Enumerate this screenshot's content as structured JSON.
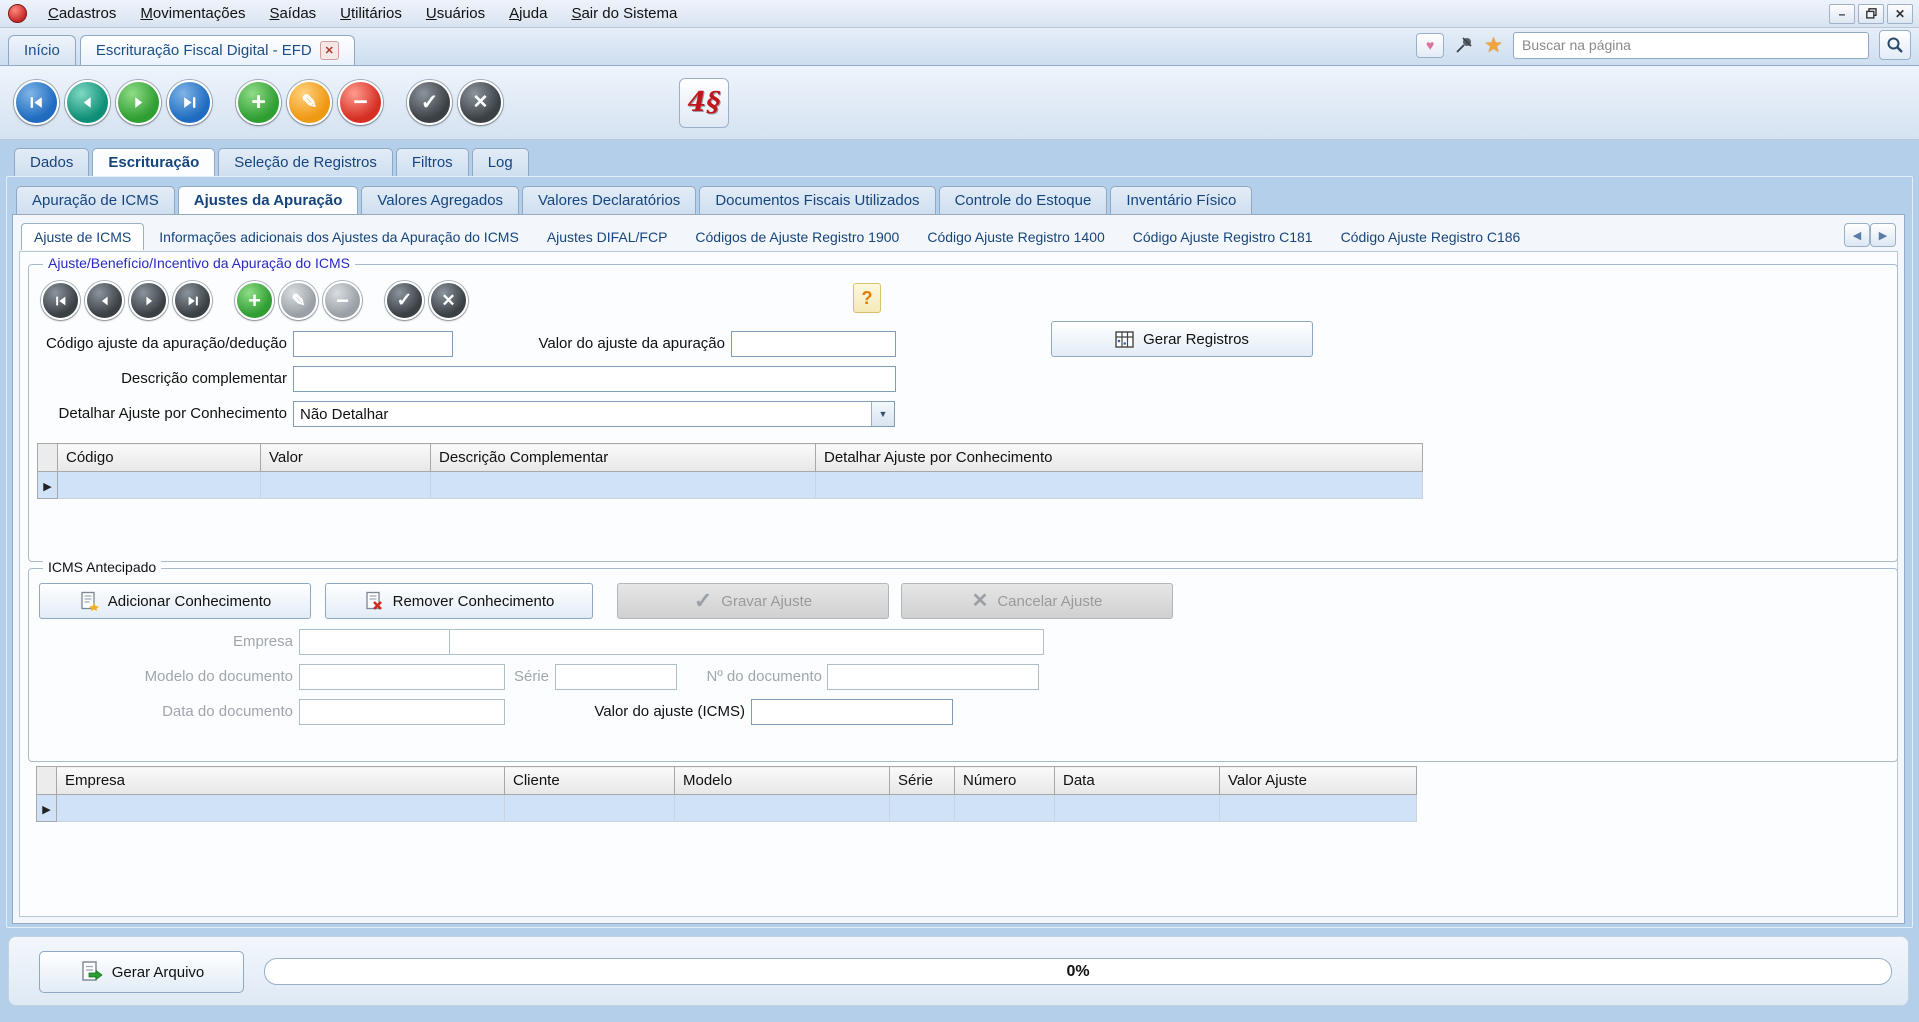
{
  "window": {
    "minimize_icon": "–",
    "close_icon": "✕"
  },
  "menubar": {
    "items": [
      "Cadastros",
      "Movimentações",
      "Saídas",
      "Utilitários",
      "Usuários",
      "Ajuda",
      "Sair do Sistema"
    ]
  },
  "tabbar": {
    "tabs": [
      {
        "label": "Início"
      },
      {
        "label": "Escrituração Fiscal Digital - EFD",
        "closable": true
      }
    ],
    "close_tab_icon": "✕",
    "heart_icon": "♥",
    "star_icon": "★",
    "search_placeholder": "Buscar na página"
  },
  "toolbar": {
    "logo_glyph": "4§"
  },
  "icons": {
    "add": "+",
    "edit": "✎",
    "delete": "−",
    "confirm": "✓",
    "cancel": "✕",
    "help": "?",
    "dropdown_arrow": "▼",
    "row_selector": "▶",
    "tab_scroll_left": "◀",
    "tab_scroll_right": "▶"
  },
  "tabs_level1": {
    "items": [
      "Dados",
      "Escrituração",
      "Seleção de Registros",
      "Filtros",
      "Log"
    ],
    "selected": "Escrituração"
  },
  "tabs_level2": {
    "items": [
      "Apuração de ICMS",
      "Ajustes da Apuração",
      "Valores Agregados",
      "Valores Declaratórios",
      "Documentos Fiscais Utilizados",
      "Controle do Estoque",
      "Inventário Físico"
    ],
    "selected": "Ajustes da Apuração"
  },
  "tabs_level3": {
    "items": [
      "Ajuste de ICMS",
      "Informações adicionais dos Ajustes da Apuração do ICMS",
      "Ajustes DIFAL/FCP",
      "Códigos de Ajuste Registro 1900",
      "Código Ajuste Registro 1400",
      "Código Ajuste Registro C181",
      "Código Ajuste Registro C186"
    ],
    "selected": "Ajuste de ICMS"
  },
  "ajuste_group": {
    "title": "Ajuste/Benefício/Incentivo da Apuração do ICMS",
    "fields": {
      "codigo_label": "Código ajuste da apuração/dedução",
      "codigo_value": "",
      "valor_label": "Valor do ajuste da apuração",
      "valor_value": "",
      "descricao_label": "Descrição complementar",
      "descricao_value": "",
      "detalhar_label": "Detalhar Ajuste por Conhecimento",
      "detalhar_value": "Não Detalhar"
    },
    "gerar_registros_label": "Gerar Registros",
    "grid": {
      "columns": [
        "Código",
        "Valor",
        "Descrição Complementar",
        "Detalhar Ajuste por Conhecimento"
      ],
      "rows": [
        [
          "",
          "",
          "",
          ""
        ]
      ]
    }
  },
  "icms_group": {
    "title": "ICMS Antecipado",
    "buttons": {
      "adicionar": "Adicionar Conhecimento",
      "remover": "Remover Conhecimento",
      "gravar": "Gravar Ajuste",
      "cancelar": "Cancelar Ajuste"
    },
    "fields": {
      "empresa_label": "Empresa",
      "empresa_codigo_value": "",
      "empresa_nome_value": "",
      "modelo_label": "Modelo do documento",
      "modelo_value": "",
      "serie_label": "Série",
      "serie_value": "",
      "numero_label": "Nº do documento",
      "numero_value": "",
      "data_label": "Data do documento",
      "data_value": "",
      "valor_label": "Valor do ajuste (ICMS)",
      "valor_value": ""
    },
    "grid": {
      "columns": [
        "Empresa",
        "Cliente",
        "Modelo",
        "Série",
        "Número",
        "Data",
        "Valor Ajuste"
      ],
      "rows": [
        [
          "",
          "",
          "",
          "",
          "",
          "",
          ""
        ]
      ]
    }
  },
  "footer": {
    "gerar_arquivo_label": "Gerar Arquivo",
    "progress_text": "0%",
    "progress_value": 0
  },
  "colors": {
    "panel_blue": "#b4cfea",
    "tab_text": "#16457e",
    "group_title_blue": "#2a2ac0",
    "green": "#2f9e33",
    "orange": "#ef9812",
    "red": "#d62f23",
    "dark": "#3b4045"
  }
}
